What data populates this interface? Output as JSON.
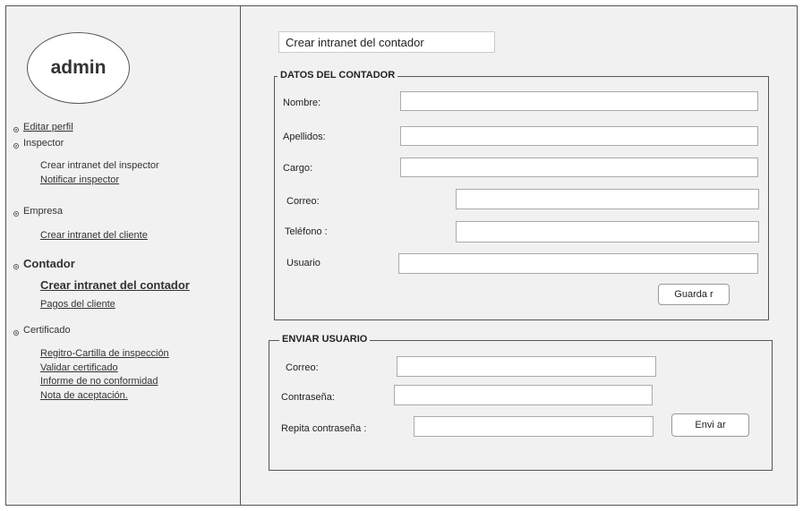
{
  "sidebar": {
    "avatar_label": "admin",
    "editar_perfil": "Editar perfil",
    "inspector": {
      "label": "Inspector",
      "items": [
        "Crear intranet del inspector",
        "Notificar inspector"
      ]
    },
    "empresa": {
      "label": "Empresa",
      "items": [
        "Crear intranet del cliente"
      ]
    },
    "contador": {
      "label": "Contador",
      "items": [
        "Crear intranet del contador",
        "Pagos del cliente"
      ]
    },
    "certificado": {
      "label": "Certificado",
      "items": [
        "Regitro-Cartilla de inspección",
        "Validar certificado",
        "Informe de no conformidad",
        "Nota de aceptación."
      ]
    }
  },
  "main": {
    "title": "Crear intranet del contador",
    "datos": {
      "legend": "DATOS DEL CONTADOR",
      "fields": [
        {
          "label": "Nombre:",
          "value": ""
        },
        {
          "label": "Apellidos:",
          "value": ""
        },
        {
          "label": "Cargo:",
          "value": ""
        },
        {
          "label": "Correo:",
          "value": ""
        },
        {
          "label": "Teléfono :",
          "value": ""
        },
        {
          "label": "Usuario",
          "value": ""
        }
      ],
      "save_label": "Guarda r"
    },
    "enviar": {
      "legend": "ENVIAR USUARIO",
      "fields": [
        {
          "label": "Correo:",
          "value": ""
        },
        {
          "label": "Contraseña:",
          "value": ""
        },
        {
          "label": "Repita contraseña  :",
          "value": ""
        }
      ],
      "send_label": "Envi ar"
    }
  }
}
